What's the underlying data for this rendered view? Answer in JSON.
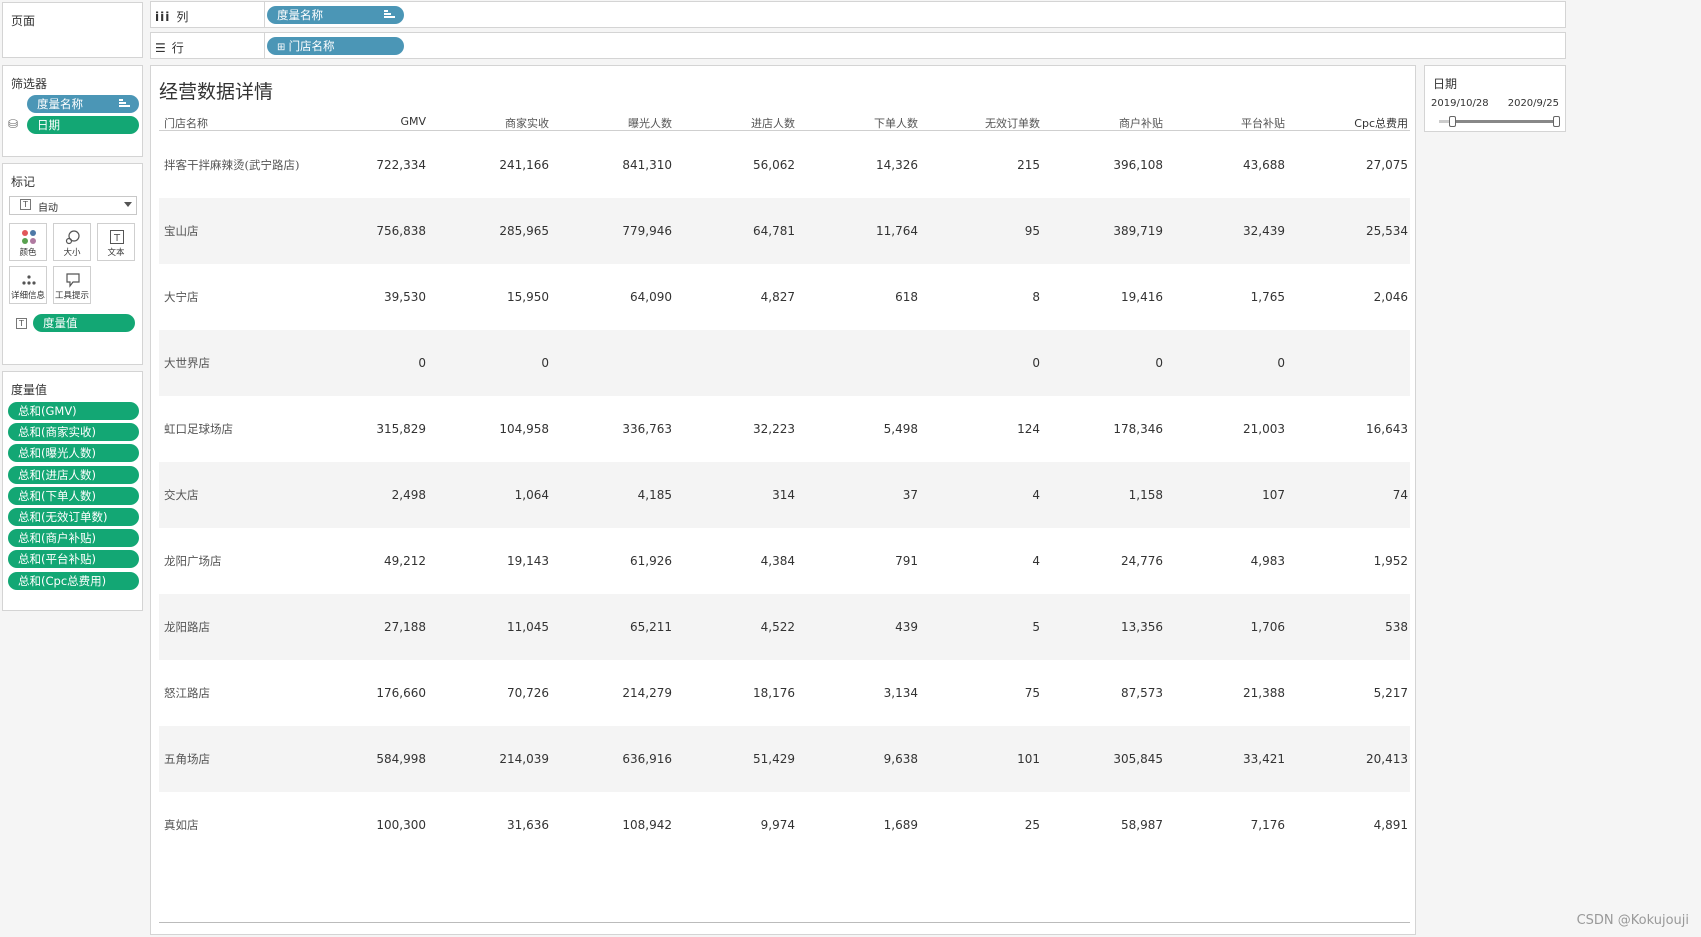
{
  "pages_panel": {
    "title": "页面"
  },
  "columns_shelf": {
    "label": "列",
    "pill": "度量名称"
  },
  "rows_shelf": {
    "label": "行",
    "pill": "门店名称"
  },
  "filters": {
    "title": "筛选器",
    "items": [
      "度量名称",
      "日期"
    ]
  },
  "marks": {
    "title": "标记",
    "type_select": "自动",
    "buttons": [
      "颜色",
      "大小",
      "文本",
      "详细信息",
      "工具提示"
    ],
    "field": "度量值"
  },
  "measure_values": {
    "title": "度量值",
    "items": [
      "总和(GMV)",
      "总和(商家实收)",
      "总和(曝光人数)",
      "总和(进店人数)",
      "总和(下单人数)",
      "总和(无效订单数)",
      "总和(商户补贴)",
      "总和(平台补贴)",
      "总和(Cpc总费用)"
    ]
  },
  "date_filter": {
    "title": "日期",
    "start": "2019/10/28",
    "end": "2020/9/25"
  },
  "table": {
    "title": "经营数据详情",
    "columns": [
      "门店名称",
      "GMV",
      "商家实收",
      "曝光人数",
      "进店人数",
      "下单人数",
      "无效订单数",
      "商户补贴",
      "平台补贴",
      "Cpc总费用"
    ],
    "rows": [
      [
        "拌客干拌麻辣烫(武宁路店)",
        "722,334",
        "241,166",
        "841,310",
        "56,062",
        "14,326",
        "215",
        "396,108",
        "43,688",
        "27,075"
      ],
      [
        "宝山店",
        "756,838",
        "285,965",
        "779,946",
        "64,781",
        "11,764",
        "95",
        "389,719",
        "32,439",
        "25,534"
      ],
      [
        "大宁店",
        "39,530",
        "15,950",
        "64,090",
        "4,827",
        "618",
        "8",
        "19,416",
        "1,765",
        "2,046"
      ],
      [
        "大世界店",
        "0",
        "0",
        "",
        "",
        "",
        "0",
        "0",
        "0",
        ""
      ],
      [
        "虹口足球场店",
        "315,829",
        "104,958",
        "336,763",
        "32,223",
        "5,498",
        "124",
        "178,346",
        "21,003",
        "16,643"
      ],
      [
        "交大店",
        "2,498",
        "1,064",
        "4,185",
        "314",
        "37",
        "4",
        "1,158",
        "107",
        "74"
      ],
      [
        "龙阳广场店",
        "49,212",
        "19,143",
        "61,926",
        "4,384",
        "791",
        "4",
        "24,776",
        "4,983",
        "1,952"
      ],
      [
        "龙阳路店",
        "27,188",
        "11,045",
        "65,211",
        "4,522",
        "439",
        "5",
        "13,356",
        "1,706",
        "538"
      ],
      [
        "怒江路店",
        "176,660",
        "70,726",
        "214,279",
        "18,176",
        "3,134",
        "75",
        "87,573",
        "21,388",
        "5,217"
      ],
      [
        "五角场店",
        "584,998",
        "214,039",
        "636,916",
        "51,429",
        "9,638",
        "101",
        "305,845",
        "33,421",
        "20,413"
      ],
      [
        "真如店",
        "100,300",
        "31,636",
        "108,942",
        "9,974",
        "1,689",
        "25",
        "58,987",
        "7,176",
        "4,891"
      ]
    ]
  },
  "watermark": "CSDN @Kokujouji",
  "colors": {
    "pill_blue": "#4b96b6",
    "pill_green": "#13a774",
    "row_shade": "#f4f4f4"
  }
}
